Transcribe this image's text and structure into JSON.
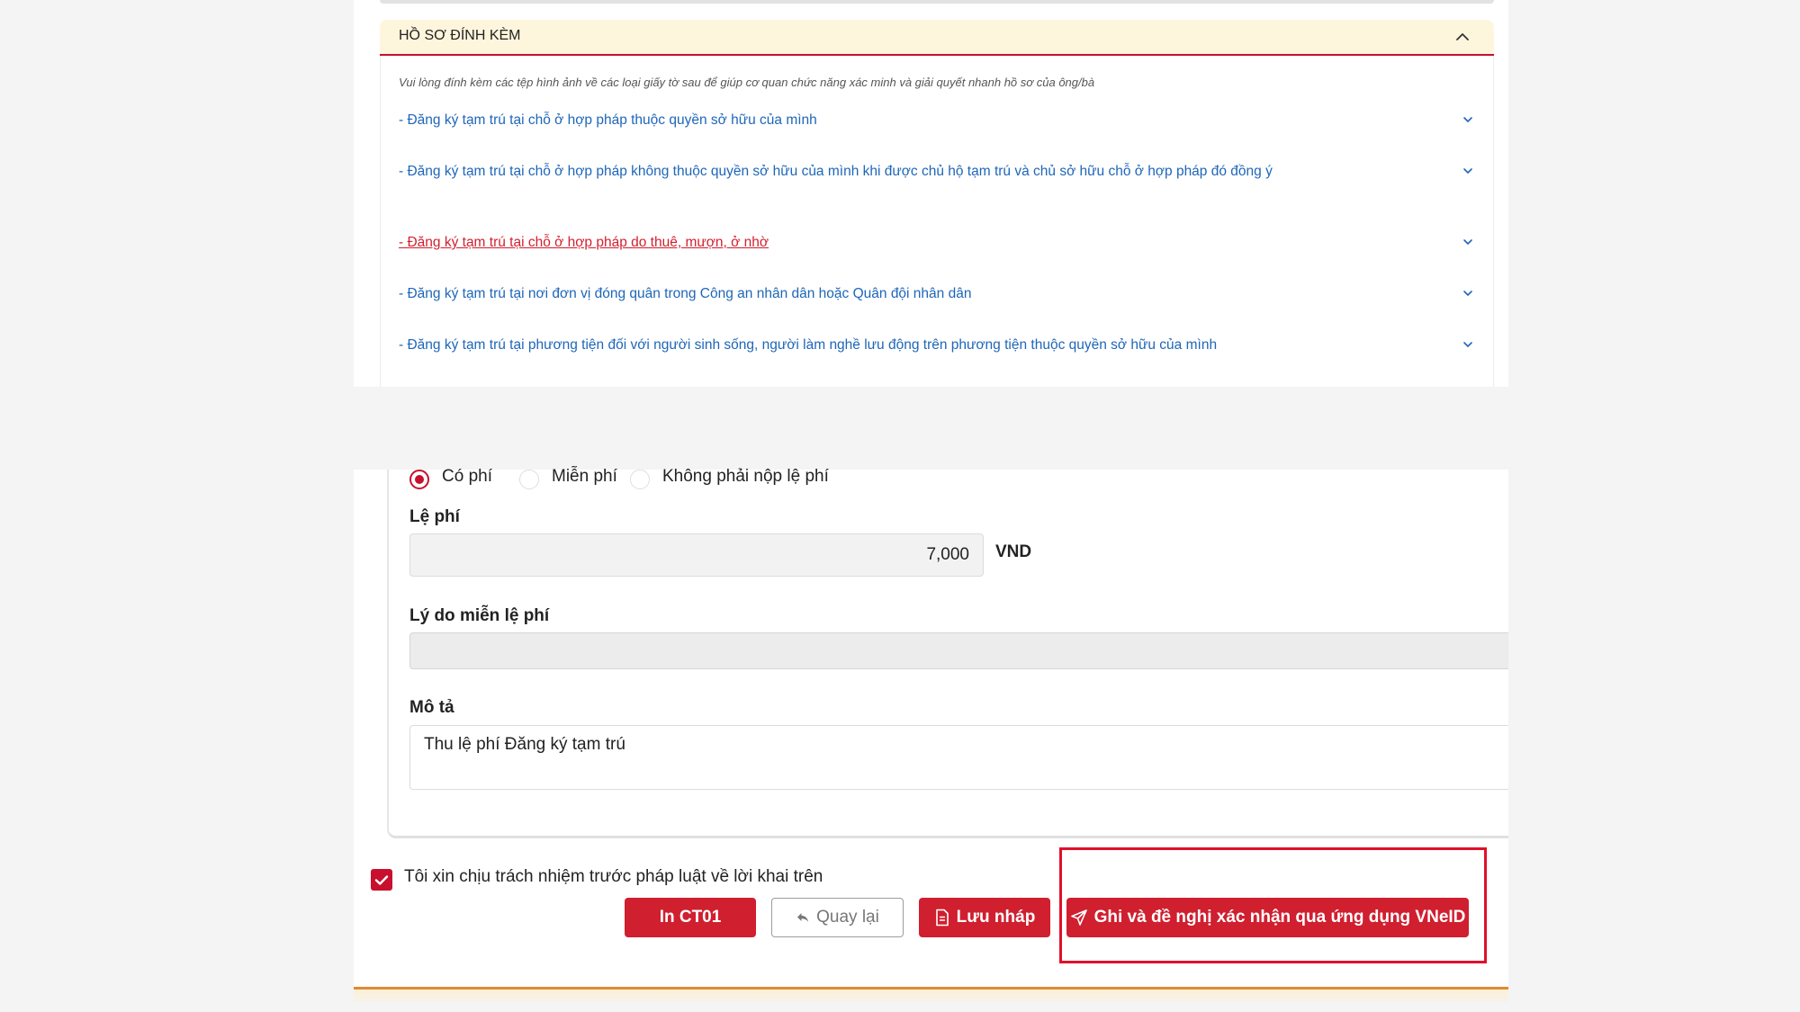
{
  "attachments": {
    "title": "HỒ SƠ ĐÍNH KÈM",
    "note": "Vui lòng đính kèm các tệp hình ảnh về các loại giấy tờ sau để giúp cơ quan chức năng xác minh và giải quyết nhanh hồ sơ của ông/bà",
    "items": [
      {
        "label": "- Đăng ký tạm trú tại chỗ ở hợp pháp thuộc quyền sở hữu của mình"
      },
      {
        "label": "- Đăng ký tạm trú tại chỗ ở hợp pháp không thuộc quyền sở hữu của mình khi được chủ hộ tạm trú và chủ sở hữu chỗ ở hợp pháp đó đồng ý"
      },
      {
        "label": "- Đăng ký tạm trú tại chỗ ở hợp pháp do thuê, mượn, ở nhờ"
      },
      {
        "label": "- Đăng ký tạm trú tại nơi đơn vị đóng quân trong Công an nhân dân hoặc Quân đội nhân dân"
      },
      {
        "label": "- Đăng ký tạm trú tại phương tiện đối với người sinh sống, người làm nghề lưu động trên phương tiện thuộc quyền sở hữu của mình"
      }
    ]
  },
  "fee_type": {
    "options": [
      "Có phí",
      "Miễn phí",
      "Không phải nộp lệ phí"
    ],
    "selected": "Có phí"
  },
  "fee": {
    "label": "Lệ phí",
    "value": "7,000",
    "unit": "VND"
  },
  "exemption_reason": {
    "label": "Lý do miễn lệ phí",
    "value": ""
  },
  "description": {
    "label": "Mô tả",
    "value": "Thu lệ phí Đăng ký tạm trú"
  },
  "declaration": {
    "label": "Tôi xin chịu trách nhiệm trước pháp luật về lời khai trên",
    "checked": true
  },
  "actions": {
    "print_label": "In CT01",
    "back_label": "Quay lại",
    "save_draft_label": "Lưu nháp",
    "submit_label": "Ghi và đề nghị xác nhận qua ứng dụng VNeID"
  },
  "colors": {
    "primary_red": "#d01f2f",
    "link_blue": "#1e66b8",
    "header_bg": "#fef6dc"
  }
}
